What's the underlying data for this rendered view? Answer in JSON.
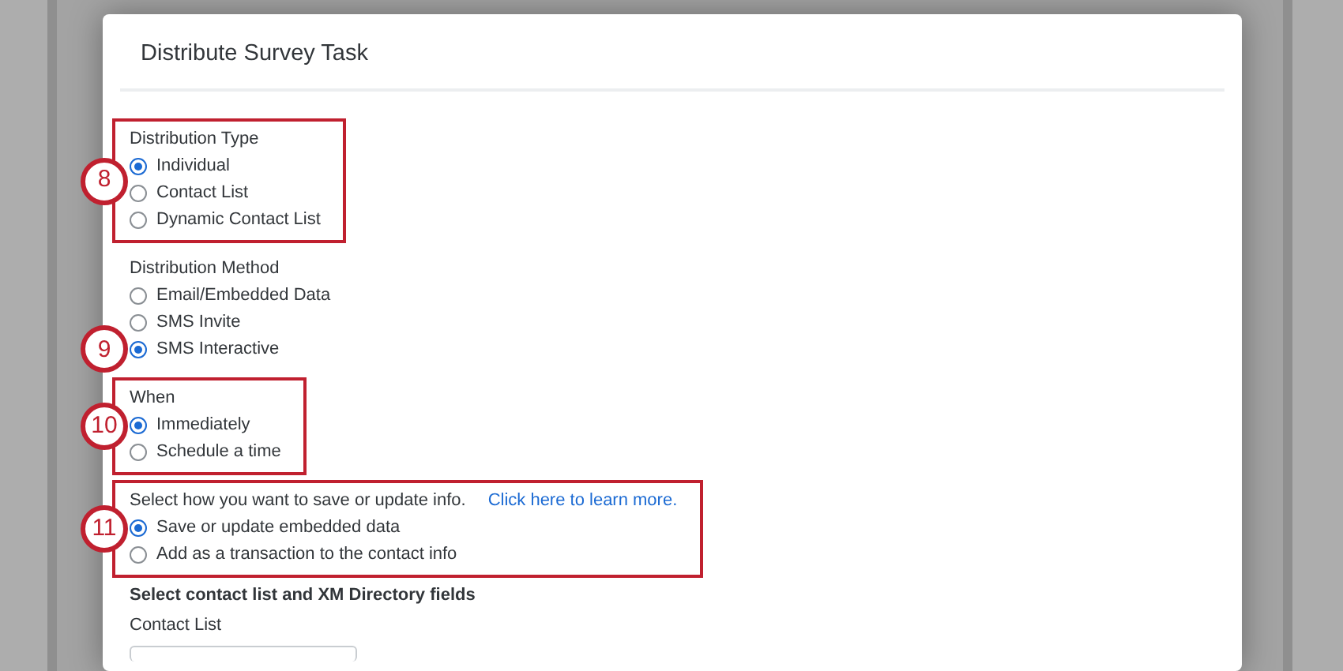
{
  "dialog": {
    "title": "Distribute Survey Task"
  },
  "sections": [
    {
      "label": "Distribution Type",
      "highlighted": true,
      "callout": "8",
      "options": [
        {
          "label": "Individual",
          "selected": true
        },
        {
          "label": "Contact List",
          "selected": false
        },
        {
          "label": "Dynamic Contact List",
          "selected": false
        }
      ]
    },
    {
      "label": "Distribution Method",
      "highlighted": false,
      "options": [
        {
          "label": "Email/Embedded Data",
          "selected": false
        },
        {
          "label": "SMS Invite",
          "selected": false
        },
        {
          "label": "SMS Interactive",
          "selected": true,
          "callout": "9"
        }
      ]
    },
    {
      "label": "When",
      "highlighted": true,
      "callout": "10",
      "options": [
        {
          "label": "Immediately",
          "selected": true
        },
        {
          "label": "Schedule a time",
          "selected": false
        }
      ]
    },
    {
      "label": "Select how you want to save or update info.",
      "link": "Click here to learn more.",
      "highlighted": true,
      "callout": "11",
      "options": [
        {
          "label": "Save or update embedded data",
          "selected": true
        },
        {
          "label": "Add as a transaction to the contact info",
          "selected": false
        }
      ]
    }
  ],
  "contact_section": {
    "heading": "Select contact list and XM Directory fields",
    "field_label": "Contact List"
  }
}
